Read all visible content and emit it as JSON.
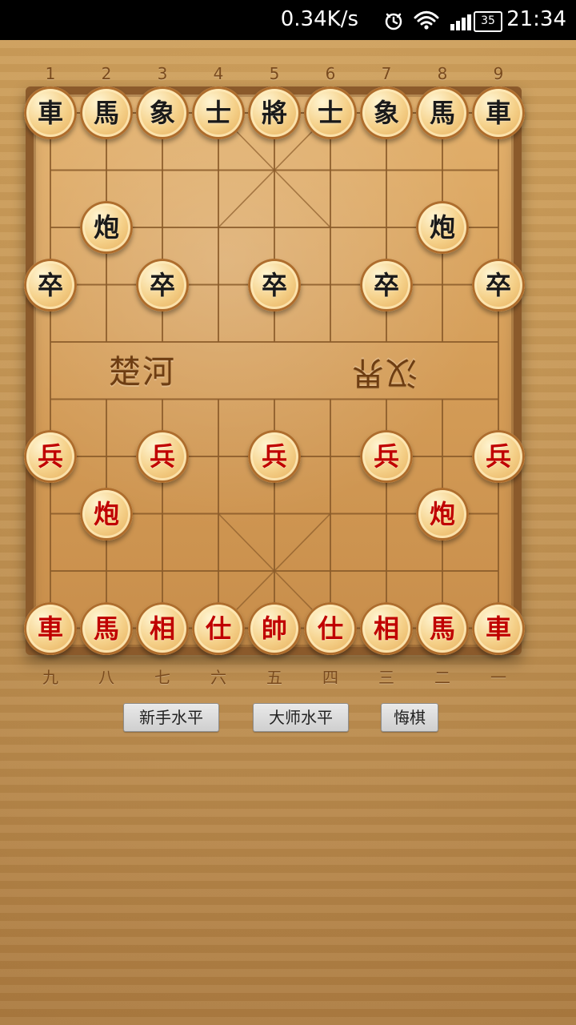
{
  "status_bar": {
    "speed": "0.34K/s",
    "battery": "35",
    "time": "21:34",
    "icons": [
      "alarm-icon",
      "wifi-icon",
      "signal-icon",
      "battery-icon"
    ]
  },
  "board": {
    "top_labels": [
      "1",
      "2",
      "3",
      "4",
      "5",
      "6",
      "7",
      "8",
      "9"
    ],
    "bottom_labels": [
      "九",
      "八",
      "七",
      "六",
      "五",
      "四",
      "三",
      "二",
      "一"
    ],
    "river_left": "楚河",
    "river_right": "汉界",
    "pieces": [
      {
        "id": "b-ju-1",
        "side": "black",
        "char": "車",
        "col": 0,
        "row": 0
      },
      {
        "id": "b-ma-1",
        "side": "black",
        "char": "馬",
        "col": 1,
        "row": 0
      },
      {
        "id": "b-xiang-1",
        "side": "black",
        "char": "象",
        "col": 2,
        "row": 0
      },
      {
        "id": "b-shi-1",
        "side": "black",
        "char": "士",
        "col": 3,
        "row": 0
      },
      {
        "id": "b-jiang",
        "side": "black",
        "char": "將",
        "col": 4,
        "row": 0
      },
      {
        "id": "b-shi-2",
        "side": "black",
        "char": "士",
        "col": 5,
        "row": 0
      },
      {
        "id": "b-xiang-2",
        "side": "black",
        "char": "象",
        "col": 6,
        "row": 0
      },
      {
        "id": "b-ma-2",
        "side": "black",
        "char": "馬",
        "col": 7,
        "row": 0
      },
      {
        "id": "b-ju-2",
        "side": "black",
        "char": "車",
        "col": 8,
        "row": 0
      },
      {
        "id": "b-pao-1",
        "side": "black",
        "char": "炮",
        "col": 1,
        "row": 2
      },
      {
        "id": "b-pao-2",
        "side": "black",
        "char": "炮",
        "col": 7,
        "row": 2
      },
      {
        "id": "b-zu-1",
        "side": "black",
        "char": "卒",
        "col": 0,
        "row": 3
      },
      {
        "id": "b-zu-2",
        "side": "black",
        "char": "卒",
        "col": 2,
        "row": 3
      },
      {
        "id": "b-zu-3",
        "side": "black",
        "char": "卒",
        "col": 4,
        "row": 3
      },
      {
        "id": "b-zu-4",
        "side": "black",
        "char": "卒",
        "col": 6,
        "row": 3
      },
      {
        "id": "b-zu-5",
        "side": "black",
        "char": "卒",
        "col": 8,
        "row": 3
      },
      {
        "id": "r-bing-1",
        "side": "red",
        "char": "兵",
        "col": 0,
        "row": 6
      },
      {
        "id": "r-bing-2",
        "side": "red",
        "char": "兵",
        "col": 2,
        "row": 6
      },
      {
        "id": "r-bing-3",
        "side": "red",
        "char": "兵",
        "col": 4,
        "row": 6
      },
      {
        "id": "r-bing-4",
        "side": "red",
        "char": "兵",
        "col": 6,
        "row": 6
      },
      {
        "id": "r-bing-5",
        "side": "red",
        "char": "兵",
        "col": 8,
        "row": 6
      },
      {
        "id": "r-pao-1",
        "side": "red",
        "char": "炮",
        "col": 1,
        "row": 7
      },
      {
        "id": "r-pao-2",
        "side": "red",
        "char": "炮",
        "col": 7,
        "row": 7
      },
      {
        "id": "r-ju-1",
        "side": "red",
        "char": "車",
        "col": 0,
        "row": 9
      },
      {
        "id": "r-ma-1",
        "side": "red",
        "char": "馬",
        "col": 1,
        "row": 9
      },
      {
        "id": "r-xiang-1",
        "side": "red",
        "char": "相",
        "col": 2,
        "row": 9
      },
      {
        "id": "r-shi-1",
        "side": "red",
        "char": "仕",
        "col": 3,
        "row": 9
      },
      {
        "id": "r-shuai",
        "side": "red",
        "char": "帥",
        "col": 4,
        "row": 9
      },
      {
        "id": "r-shi-2",
        "side": "red",
        "char": "仕",
        "col": 5,
        "row": 9
      },
      {
        "id": "r-xiang-2",
        "side": "red",
        "char": "相",
        "col": 6,
        "row": 9
      },
      {
        "id": "r-ma-2",
        "side": "red",
        "char": "馬",
        "col": 7,
        "row": 9
      },
      {
        "id": "r-ju-2",
        "side": "red",
        "char": "車",
        "col": 8,
        "row": 9
      }
    ]
  },
  "buttons": {
    "beginner": "新手水平",
    "master": "大师水平",
    "undo": "悔棋"
  }
}
